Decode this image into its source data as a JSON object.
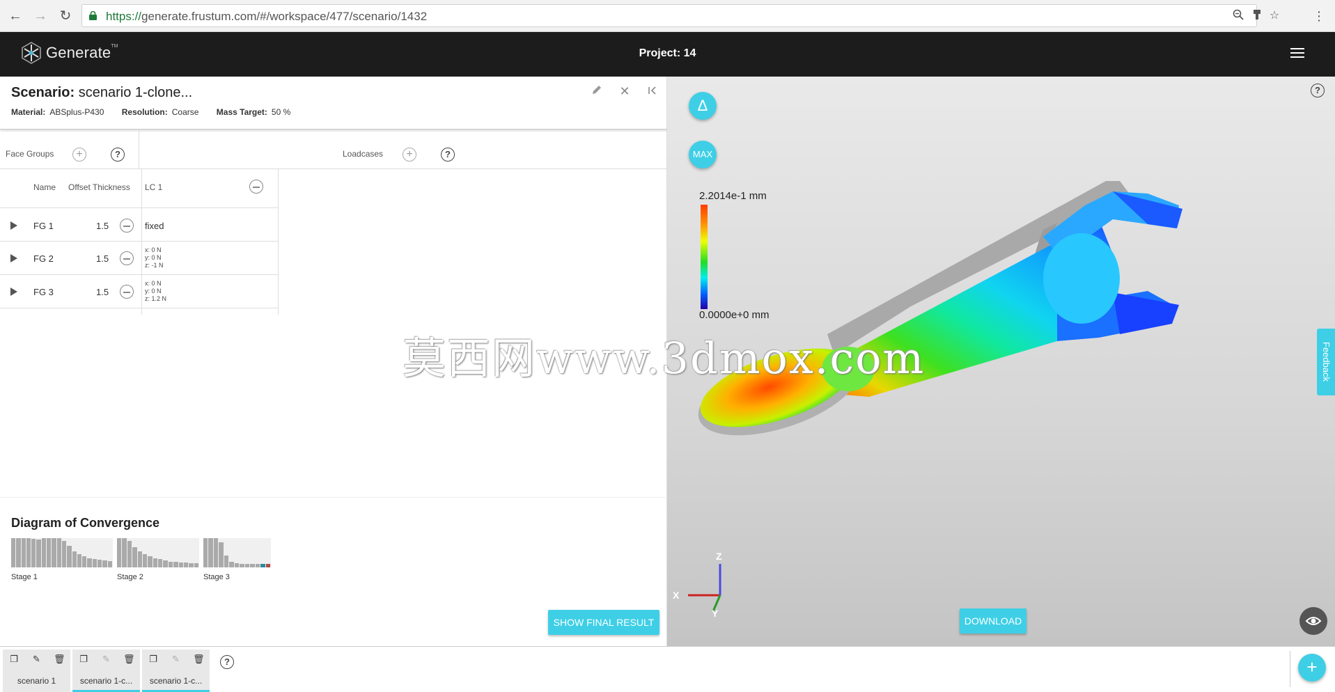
{
  "browser": {
    "url_scheme": "https://",
    "url_rest": "generate.frustum.com/#/workspace/477/scenario/1432"
  },
  "app": {
    "logo_text": "Generate",
    "logo_tm": "TM",
    "project_title": "Project: 14"
  },
  "scenario": {
    "title_label": "Scenario:",
    "title_value": "scenario 1-clone...",
    "material_label": "Material:",
    "material_value": "ABSplus-P430",
    "resolution_label": "Resolution:",
    "resolution_value": "Coarse",
    "mass_label": "Mass Target:",
    "mass_value": "50 %"
  },
  "groups": {
    "face_groups_label": "Face Groups",
    "loadcases_label": "Loadcases",
    "help_glyph": "?",
    "add_glyph": "+"
  },
  "table": {
    "col_name": "Name",
    "col_offset": "Offset Thickness",
    "col_lc": "LC 1",
    "rows": [
      {
        "name": "FG 1",
        "offset": "1.5",
        "lc": "fixed",
        "fx": "",
        "fy": "",
        "fz": ""
      },
      {
        "name": "FG 2",
        "offset": "1.5",
        "lc": "",
        "fx": "x: 0 N",
        "fy": "y: 0 N",
        "fz": "z: -1 N"
      },
      {
        "name": "FG 3",
        "offset": "1.5",
        "lc": "",
        "fx": "x: 0 N",
        "fy": "y: 0 N",
        "fz": "z: 1.2 N"
      }
    ]
  },
  "convergence": {
    "title": "Diagram of Convergence",
    "stages": [
      {
        "label": "Stage 1",
        "bars": [
          1,
          1,
          1,
          1,
          0.98,
          0.95,
          1,
          1,
          1,
          1,
          0.9,
          0.75,
          0.55,
          0.45,
          0.38,
          0.32,
          0.28,
          0.26,
          0.24,
          0.22
        ]
      },
      {
        "label": "Stage 2",
        "bars": [
          1,
          1,
          0.9,
          0.7,
          0.55,
          0.45,
          0.38,
          0.32,
          0.28,
          0.24,
          0.2,
          0.18,
          0.16,
          0.16,
          0.15,
          0.15
        ]
      },
      {
        "label": "Stage 3",
        "bars": [
          1,
          1,
          1,
          0.85,
          0.4,
          0.18,
          0.14,
          0.13,
          0.12,
          0.12,
          0.12,
          0.12,
          0.12
        ]
      }
    ],
    "stage3_highlight_color": "#2a8a9a",
    "stage3_last_color": "#b04a4a"
  },
  "buttons": {
    "show_final_result": "SHOW FINAL RESULT",
    "download": "DOWNLOAD",
    "delta": "Δ",
    "max": "MAX",
    "feedback": "Feedback"
  },
  "viewer": {
    "legend_max": "2.2014e-1 mm",
    "legend_min": "0.0000e+0 mm",
    "axis_x": "X",
    "axis_y": "Y",
    "axis_z": "Z",
    "accent_color": "#3ecfe6"
  },
  "watermark": "莫西网www.3dmox.com",
  "tabs": [
    {
      "label": "scenario 1",
      "active": false,
      "edit_enabled": true
    },
    {
      "label": "scenario 1-c...",
      "active": true,
      "edit_enabled": false
    },
    {
      "label": "scenario 1-c...",
      "active": true,
      "edit_enabled": false
    }
  ]
}
